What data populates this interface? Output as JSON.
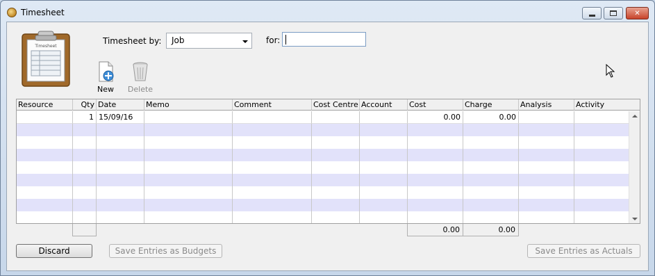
{
  "window": {
    "title": "Timesheet",
    "controls": {
      "minimize": "minimize",
      "maximize": "maximize",
      "close": "✕"
    }
  },
  "form": {
    "timesheet_by_label": "Timesheet by:",
    "timesheet_by_value": "Job",
    "for_label": "for:",
    "for_value": ""
  },
  "toolbar": {
    "new_label": "New",
    "delete_label": "Delete"
  },
  "clipboard_label": "Timesheet",
  "grid": {
    "columns": [
      "Resource",
      "Qty",
      "Date",
      "Memo",
      "Comment",
      "Cost Centre",
      "Account",
      "Cost",
      "Charge",
      "Analysis",
      "Activity"
    ],
    "rows": [
      {
        "resource": "",
        "qty": "1",
        "date": "15/09/16",
        "memo": "",
        "comment": "",
        "cost_centre": "",
        "account": "",
        "cost": "0.00",
        "charge": "0.00",
        "analysis": "",
        "activity": ""
      }
    ],
    "totals": {
      "cost": "0.00",
      "charge": "0.00"
    },
    "alt_row_color": "#e2e2fa"
  },
  "buttons": {
    "discard": "Discard",
    "save_budgets": "Save Entries as Budgets",
    "save_actuals": "Save Entries as Actuals"
  }
}
